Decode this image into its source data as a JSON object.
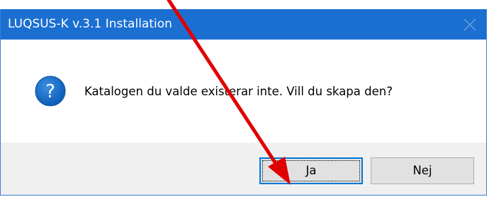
{
  "window": {
    "title": "LUQSUS-K v.3.1 Installation",
    "close_icon": "close-icon"
  },
  "message": {
    "icon": "question-icon",
    "text": "Katalogen du valde existerar inte. Vill du skapa den?"
  },
  "buttons": {
    "yes_label": "Ja",
    "no_label": "Nej"
  },
  "annotation": {
    "arrow_color": "#e00000"
  },
  "colors": {
    "titlebar": "#1a6fd1",
    "accent": "#0078d7"
  }
}
